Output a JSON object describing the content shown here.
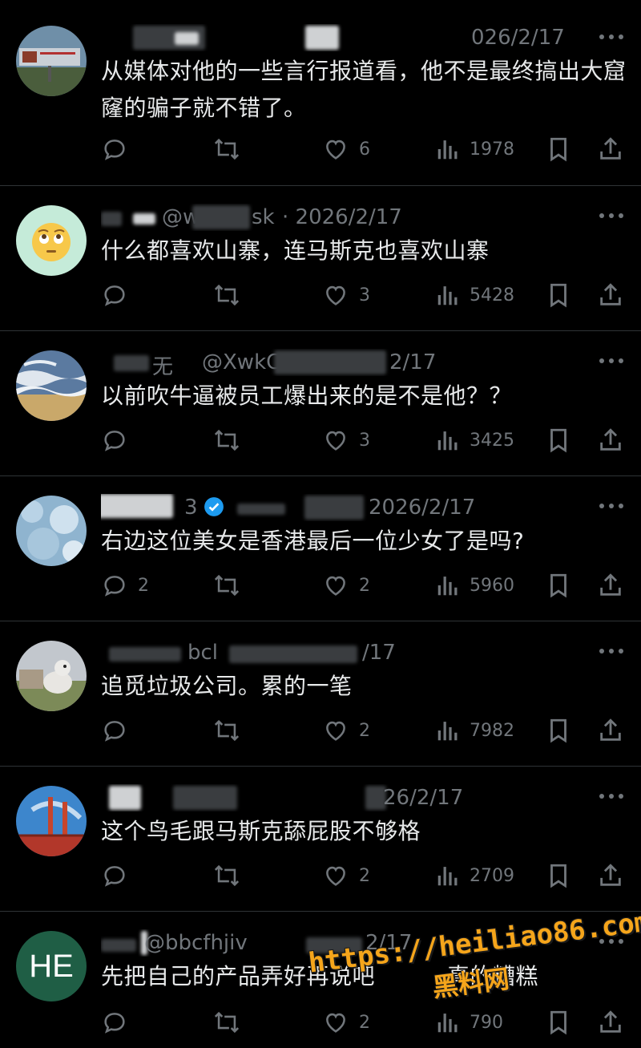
{
  "colors": {
    "background": "#000000",
    "text": "#e7e9ea",
    "muted": "#71767b",
    "divider": "#2f3336",
    "verified": "#1d9bf0",
    "watermark": "#f5a51b"
  },
  "icons": {
    "reply": "speech-bubble",
    "retweet": "repost-arrows",
    "like": "heart",
    "views": "bar-chart",
    "bookmark": "bookmark",
    "share": "share-arrow",
    "more": "three-dots"
  },
  "replies": [
    {
      "handle": "",
      "date": "026/2/17",
      "text": "从媒体对他的一些言行报道看，他不是最终搞出大窟窿的骗子就不错了。",
      "reply_count": "",
      "likes": "6",
      "views": "1978"
    },
    {
      "handle": "@w",
      "handle2": "sk",
      "date": "· 2026/2/17",
      "text": "什么都喜欢山寨，连马斯克也喜欢山寨",
      "reply_count": "",
      "likes": "3",
      "views": "5428"
    },
    {
      "handle": "无",
      "handle2": "@XwkC",
      "date": "2/17",
      "text": "以前吹牛逼被员工爆出来的是不是他？？",
      "reply_count": "",
      "likes": "3",
      "views": "3425"
    },
    {
      "handle": "3",
      "date": "2026/2/17",
      "text": "右边这位美女是香港最后一位少女了是吗?",
      "reply_count": "2",
      "likes": "2",
      "views": "5960"
    },
    {
      "handle": "bcl",
      "date": "/17",
      "text": "追觅垃圾公司。累的一笔",
      "reply_count": "",
      "likes": "2",
      "views": "7982"
    },
    {
      "handle": "",
      "date": "26/2/17",
      "text": "这个鸟毛跟马斯克舔屁股不够格",
      "reply_count": "",
      "likes": "2",
      "views": "2709"
    },
    {
      "handle": "@bbcfhjiv",
      "date": "2/17",
      "avatar_initials": "HE",
      "text": "先把自己的产品弄好再说吧",
      "text2": "真的糟糕",
      "reply_count": "",
      "likes": "2",
      "views": "790"
    }
  ],
  "watermark": {
    "url": "https://heiliao86.com",
    "name": "黑料网"
  }
}
